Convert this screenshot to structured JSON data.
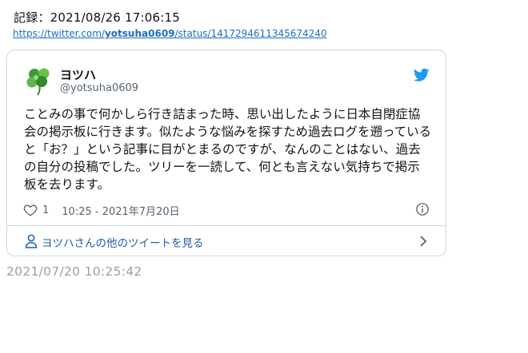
{
  "record": "記録：2021/08/26 17:06:15",
  "source_url": {
    "prefix": "https://twitter.com/",
    "user": "yotsuha0609",
    "suffix": "/status/1417294611345674240"
  },
  "tweet": {
    "display_name": "ヨツハ",
    "handle": "@yotsuha0609",
    "text": "ことみの事で何かしら行き詰まった時、思い出したように日本自閉症協会の掲示板に行きます。似たような悩みを探すため過去ログを遡っていると「お？」という記事に目がとまるのですが、なんのことはない、過去の自分の投稿でした。ツリーを一読して、何とも言えない気持ちで掲示板を去ります。",
    "like_count": "1",
    "posted_at": "10:25 - 2021年7月20日",
    "more_tweets_label": "ヨツハさんの他のツイートを見る"
  },
  "timestamp": "2021/07/20 10:25:42",
  "colors": {
    "twitter_blue": "#1d9bf0",
    "link": "#1b6ec2",
    "muted": "#536471",
    "border": "#cfd9de",
    "avatar_green": "#4caf50"
  },
  "icons": [
    "avatar-clover",
    "twitter-bird-icon",
    "heart-icon",
    "info-icon",
    "person-icon",
    "chevron-right-icon"
  ]
}
